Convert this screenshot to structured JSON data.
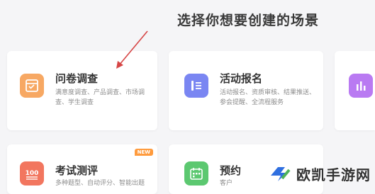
{
  "header": {
    "title": "选择你想要创建的场景"
  },
  "cards": [
    {
      "title": "问卷调查",
      "desc": "满意度调查、产品调查、市场调查、学生调查",
      "icon": "survey-icon",
      "color": "#f5a15a"
    },
    {
      "title": "活动报名",
      "desc": "活动报名、资质审核、结果推送、参会提醒、全流程服务",
      "icon": "form-icon",
      "color": "#6f7cf0"
    },
    {
      "title": "",
      "desc": "",
      "icon": "chart-icon",
      "color": "#b06ef0"
    },
    {
      "title": "考试测评",
      "desc": "多种题型、自动评分、智能出题",
      "icon": "exam-icon",
      "color": "#f0705a",
      "badge": "NEW"
    },
    {
      "title": "预约",
      "desc": "客户",
      "icon": "calendar-icon",
      "color": "#56c46a"
    }
  ],
  "watermark": {
    "text": "欧凯手游网",
    "logo": "ok-logo-icon"
  },
  "colors": {
    "background": "#f5f5f7",
    "arrow": "#d64545"
  }
}
